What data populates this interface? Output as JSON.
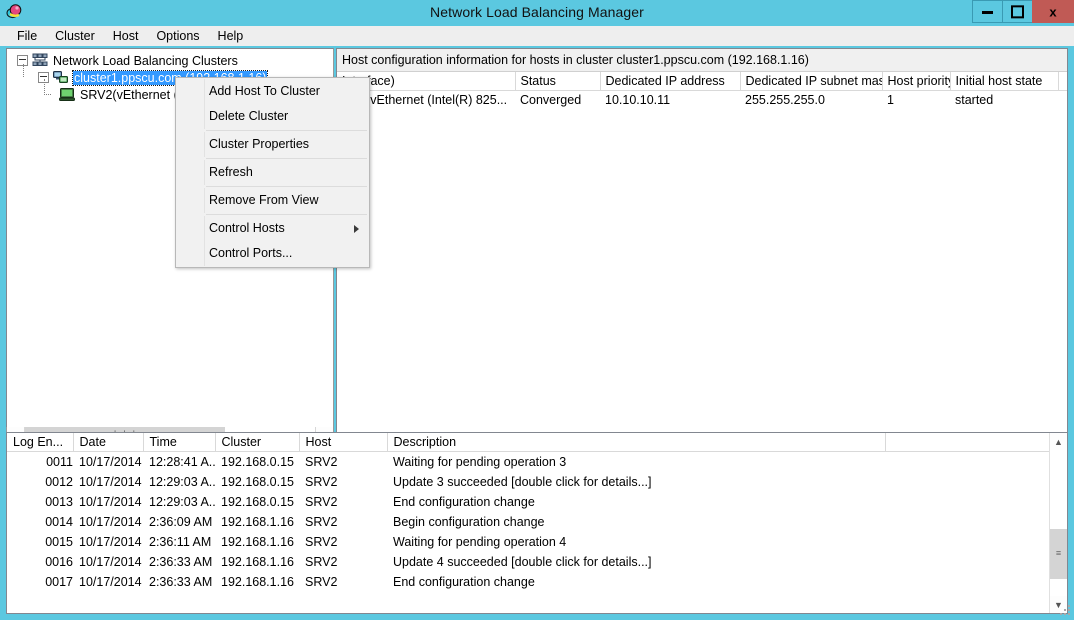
{
  "window": {
    "title": "Network Load Balancing Manager",
    "app_icon": "nlb-app-icon",
    "minimize_label": "Minimize",
    "maximize_label": "Maximize",
    "close_label": "x"
  },
  "menubar": {
    "items": [
      {
        "label": "File"
      },
      {
        "label": "Cluster"
      },
      {
        "label": "Host"
      },
      {
        "label": "Options"
      },
      {
        "label": "Help"
      }
    ]
  },
  "tree": {
    "root": {
      "label": "Network Load Balancing Clusters"
    },
    "cluster": {
      "label": "cluster1.ppscu.com (192.168.1.16)"
    },
    "host": {
      "label": "SRV2(vEthernet ("
    }
  },
  "context_menu": {
    "items": [
      {
        "label": "Add Host To Cluster",
        "submenu": false,
        "separator_after": false
      },
      {
        "label": "Delete Cluster",
        "submenu": false,
        "separator_after": true
      },
      {
        "label": "Cluster Properties",
        "submenu": false,
        "separator_after": true
      },
      {
        "label": "Refresh",
        "submenu": false,
        "separator_after": true
      },
      {
        "label": "Remove From View",
        "submenu": false,
        "separator_after": true
      },
      {
        "label": "Control Hosts",
        "submenu": true,
        "separator_after": false
      },
      {
        "label": "Control Ports...",
        "submenu": false,
        "separator_after": false
      }
    ]
  },
  "host_pane": {
    "banner": "Host configuration information for hosts in cluster cluster1.ppscu.com (192.168.1.16)",
    "columns": [
      {
        "label": "Interface)"
      },
      {
        "label": "Status"
      },
      {
        "label": "Dedicated IP address"
      },
      {
        "label": "Dedicated IP subnet mask"
      },
      {
        "label": "Host priority"
      },
      {
        "label": "Initial host state"
      },
      {
        "label": ""
      }
    ],
    "rows": [
      {
        "host": "RV2(vEthernet (Intel(R) 825...",
        "status": "Converged",
        "dedicated_ip": "10.10.10.11",
        "subnet_mask": "255.255.255.0",
        "priority": "1",
        "initial_state": "started",
        "extra": ""
      }
    ]
  },
  "log_pane": {
    "columns": [
      {
        "label": "Log En..."
      },
      {
        "label": "Date"
      },
      {
        "label": "Time"
      },
      {
        "label": "Cluster"
      },
      {
        "label": "Host"
      },
      {
        "label": "Description"
      },
      {
        "label": ""
      }
    ],
    "rows": [
      {
        "entry": "0011",
        "date": "10/17/2014",
        "time": "12:28:41 A...",
        "cluster": "192.168.0.15",
        "host": "SRV2",
        "description": "Waiting for pending operation 3"
      },
      {
        "entry": "0012",
        "date": "10/17/2014",
        "time": "12:29:03 A...",
        "cluster": "192.168.0.15",
        "host": "SRV2",
        "description": "Update 3 succeeded [double click for details...]"
      },
      {
        "entry": "0013",
        "date": "10/17/2014",
        "time": "12:29:03 A...",
        "cluster": "192.168.0.15",
        "host": "SRV2",
        "description": "End configuration change"
      },
      {
        "entry": "0014",
        "date": "10/17/2014",
        "time": "2:36:09 AM",
        "cluster": "192.168.1.16",
        "host": "SRV2",
        "description": "Begin configuration change"
      },
      {
        "entry": "0015",
        "date": "10/17/2014",
        "time": "2:36:11 AM",
        "cluster": "192.168.1.16",
        "host": "SRV2",
        "description": "Waiting for pending operation 4"
      },
      {
        "entry": "0016",
        "date": "10/17/2014",
        "time": "2:36:33 AM",
        "cluster": "192.168.1.16",
        "host": "SRV2",
        "description": "Update 4 succeeded [double click for details...]"
      },
      {
        "entry": "0017",
        "date": "10/17/2014",
        "time": "2:36:33 AM",
        "cluster": "192.168.1.16",
        "host": "SRV2",
        "description": "End configuration change"
      }
    ]
  },
  "scrollbars": {
    "tree_h_left": "‹",
    "tree_h_right": "›",
    "tree_h_grip": "❘❘❘",
    "log_v_up": "▲",
    "log_v_down": "▼",
    "log_v_grip": "≡"
  },
  "colors": {
    "titlebar": "#5bc8e0",
    "close_button": "#c05a55",
    "selection": "#3399ff",
    "pane_bg": "#ffffff",
    "menubar_bg": "#eeeeee"
  }
}
